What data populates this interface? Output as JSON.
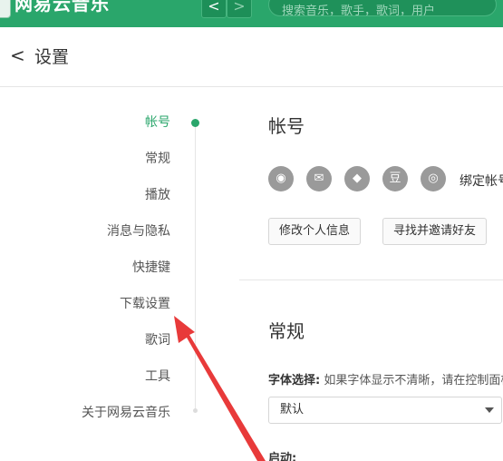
{
  "topbar": {
    "app_title": "网易云音乐",
    "back_glyph": "<",
    "forward_glyph": ">",
    "search_placeholder": "搜索音乐，歌手，歌词，用户"
  },
  "header": {
    "back_glyph": "<",
    "title": "设置"
  },
  "menu": {
    "items": [
      {
        "label": "帐号",
        "active": true
      },
      {
        "label": "常规"
      },
      {
        "label": "播放"
      },
      {
        "label": "消息与隐私"
      },
      {
        "label": "快捷键"
      },
      {
        "label": "下载设置"
      },
      {
        "label": "歌词"
      },
      {
        "label": "工具"
      },
      {
        "label": "关于网易云音乐"
      }
    ]
  },
  "account": {
    "title": "帐号",
    "social_icons": [
      {
        "name": "weibo-icon",
        "glyph": "◉"
      },
      {
        "name": "wechat-icon",
        "glyph": "✉"
      },
      {
        "name": "qq-icon",
        "glyph": "◆"
      },
      {
        "name": "douban-icon",
        "glyph": "豆"
      },
      {
        "name": "netease-icon",
        "glyph": "◎"
      }
    ],
    "bind_label": "绑定帐号",
    "edit_profile_button": "修改个人信息",
    "invite_friends_button": "寻找并邀请好友"
  },
  "general": {
    "title": "常规",
    "font_label_bold": "字体选择:",
    "font_label_hint": " 如果字体显示不清晰，请在控制面板",
    "font_value": "默认",
    "startup_label": "启动:"
  },
  "colors": {
    "accent": "#2aa66b",
    "annotation": "#e83a3a"
  }
}
